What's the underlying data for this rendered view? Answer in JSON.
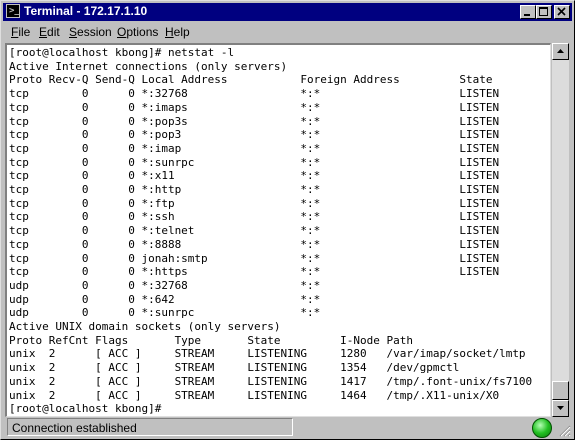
{
  "window": {
    "title": "Terminal - 172.17.1.10",
    "icon": "terminal-icon",
    "controls": [
      "minimize-icon",
      "maximize-icon",
      "close-icon"
    ]
  },
  "menu": {
    "file": "File",
    "edit": "Edit",
    "session": "Session",
    "options": "Options",
    "help": "Help"
  },
  "terminal": {
    "lines": [
      "[root@localhost kbong]# netstat -l",
      "Active Internet connections (only servers)",
      "Proto Recv-Q Send-Q Local Address           Foreign Address         State",
      "tcp        0      0 *:32768                 *:*                     LISTEN",
      "tcp        0      0 *:imaps                 *:*                     LISTEN",
      "tcp        0      0 *:pop3s                 *:*                     LISTEN",
      "tcp        0      0 *:pop3                  *:*                     LISTEN",
      "tcp        0      0 *:imap                  *:*                     LISTEN",
      "tcp        0      0 *:sunrpc                *:*                     LISTEN",
      "tcp        0      0 *:x11                   *:*                     LISTEN",
      "tcp        0      0 *:http                  *:*                     LISTEN",
      "tcp        0      0 *:ftp                   *:*                     LISTEN",
      "tcp        0      0 *:ssh                   *:*                     LISTEN",
      "tcp        0      0 *:telnet                *:*                     LISTEN",
      "tcp        0      0 *:8888                  *:*                     LISTEN",
      "tcp        0      0 jonah:smtp              *:*                     LISTEN",
      "tcp        0      0 *:https                 *:*                     LISTEN",
      "udp        0      0 *:32768                 *:*",
      "udp        0      0 *:642                   *:*",
      "udp        0      0 *:sunrpc                *:*",
      "Active UNIX domain sockets (only servers)",
      "Proto RefCnt Flags       Type       State         I-Node Path",
      "unix  2      [ ACC ]     STREAM     LISTENING     1280   /var/imap/socket/lmtp",
      "unix  2      [ ACC ]     STREAM     LISTENING     1354   /dev/gpmctl",
      "unix  2      [ ACC ]     STREAM     LISTENING     1417   /tmp/.font-unix/fs7100",
      "unix  2      [ ACC ]     STREAM     LISTENING     1464   /tmp/.X11-unix/X0",
      "[root@localhost kbong]# "
    ]
  },
  "status": {
    "text": "Connection established",
    "indicator_color": "#22c022"
  },
  "colors": {
    "titlebar": "#000080",
    "chrome": "#c0c0c0",
    "terminal_bg": "#ffffff"
  }
}
